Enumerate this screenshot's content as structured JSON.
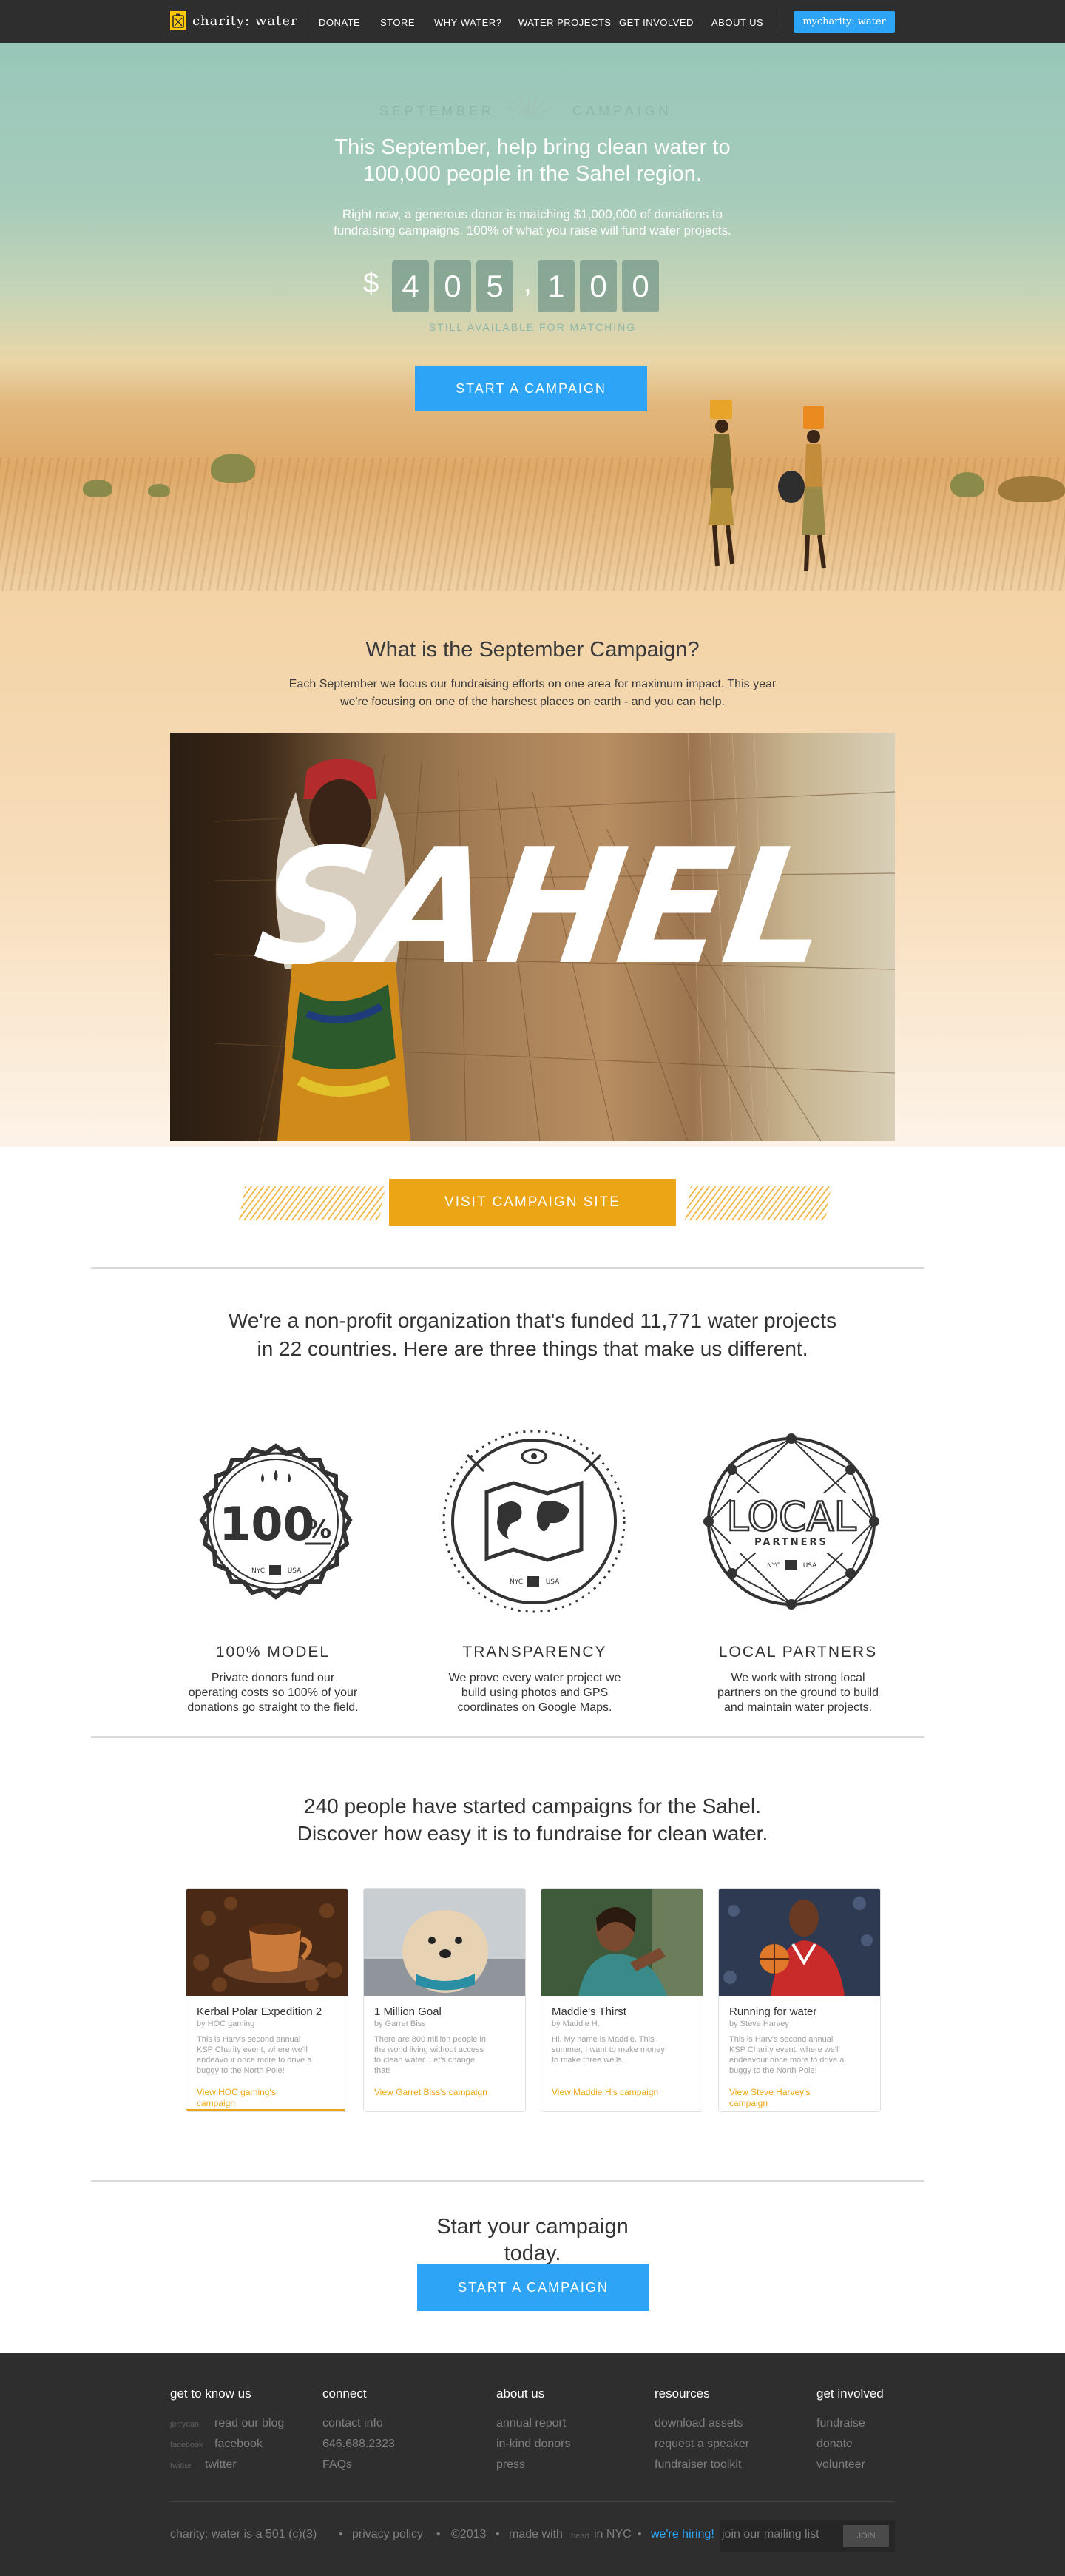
{
  "nav": {
    "logo_text": "charity: water",
    "items": [
      "DONATE",
      "STORE",
      "WHY WATER?",
      "WATER PROJECTS",
      "GET INVOLVED",
      "ABOUT US"
    ],
    "mycharity_label": "mycharity: water",
    "colors": {
      "bg": "#2e2e2e",
      "accent": "#2ea4f7",
      "logo": "#ffc907"
    }
  },
  "hero": {
    "label_left": "SEPTEMBER",
    "label_right": "CAMPAIGN",
    "headline_line1": "This September, help bring clean water to",
    "headline_line2": "100,000 people in the Sahel region.",
    "body_line1": "Right now, a generous donor is matching $1,000,000 of donations to",
    "body_line2": "fundraising campaigns. 100% of what you raise will fund water projects.",
    "counter": {
      "currency": "$",
      "digits": [
        "4",
        "0",
        "5",
        "1",
        "0",
        "0"
      ],
      "separator": ",",
      "caption": "STILL AVAILABLE FOR MATCHING"
    },
    "cta_label": "START A CAMPAIGN"
  },
  "what": {
    "heading": "What is the September Campaign?",
    "body_line1": "Each September we focus our fundraising efforts on one area for maximum impact. This year",
    "body_line2": "we're focusing on one of the harshest places on earth - and you can help.",
    "hero_word": "SAHEL",
    "cta_label": "VISIT CAMPAIGN SITE"
  },
  "mission": {
    "line1": "We're a non-profit organization that's funded 11,771 water projects",
    "line2": "in 22 countries. Here are three things that make us different."
  },
  "features": [
    {
      "title": "100% MODEL",
      "lines": [
        "Private donors fund our",
        "operating costs so 100% of your",
        "donations go straight to the field."
      ],
      "badge_text": "100",
      "badge_suffix": "%",
      "badge_small_left": "NYC",
      "badge_small_right": "USA"
    },
    {
      "title": "TRANSPARENCY",
      "lines": [
        "We prove every water project we",
        "build using photos and GPS",
        "coordinates on Google Maps."
      ],
      "badge_small_left": "NYC",
      "badge_small_right": "USA"
    },
    {
      "title": "LOCAL PARTNERS",
      "lines": [
        "We work with strong local",
        "partners on the ground to build",
        "and maintain water projects."
      ],
      "badge_text": "LOCAL",
      "badge_sub": "PARTNERS",
      "badge_small_left": "NYC",
      "badge_small_right": "USA"
    }
  ],
  "campaigns": {
    "line1": "240 people have started campaigns for the Sahel.",
    "line2": "Discover how easy it is to fundraise for clean water.",
    "cards": [
      {
        "title": "Kerbal Polar Expedition 2",
        "by": "by HOC gaming",
        "desc": [
          "This is Harv's second annual",
          "KSP Charity event, where we'll",
          "endeavour once more to drive a",
          "buggy to the North Pole!"
        ],
        "link": [
          "View HOC gaming's",
          "campaign"
        ],
        "progress": 0.98
      },
      {
        "title": "1 Million Goal",
        "by": "by Garret Biss",
        "desc": [
          "There are 800 million people in",
          "the world living without access",
          "to clean water. Let's change",
          "that!"
        ],
        "link": [
          "View Garret Biss's campaign"
        ],
        "progress": 0
      },
      {
        "title": "Maddie's Thirst",
        "by": "by Maddie H.",
        "desc": [
          "Hi. My name is Maddie. This",
          "summer, I want to make money",
          "to make three wells."
        ],
        "link": [
          "View Maddie H's campaign"
        ],
        "progress": 0
      },
      {
        "title": "Running for water",
        "by": "by Steve Harvey",
        "desc": [
          "This is Harv's second annual",
          "KSP Charity event, where we'll",
          "endeavour once more to drive a",
          "buggy to the North Pole!"
        ],
        "link": [
          "View Steve Harvey's",
          "campaign"
        ],
        "progress": 0
      }
    ]
  },
  "start": {
    "line1": "Start your campaign",
    "line2": "today.",
    "cta_label": "START A CAMPAIGN"
  },
  "footer": {
    "columns": [
      {
        "heading": "get to know us",
        "links": [
          {
            "tag": "jerrycan",
            "label": "read our blog"
          },
          {
            "tag": "facebook",
            "label": "facebook"
          },
          {
            "tag": "twitter",
            "label": "twitter"
          }
        ]
      },
      {
        "heading": "connect",
        "links": [
          {
            "label": "contact info"
          },
          {
            "label": "646.688.2323"
          },
          {
            "label": "FAQs"
          }
        ]
      },
      {
        "heading": "about us",
        "links": [
          {
            "label": "annual report"
          },
          {
            "label": "in-kind donors"
          },
          {
            "label": "press"
          }
        ]
      },
      {
        "heading": "resources",
        "links": [
          {
            "label": "download assets"
          },
          {
            "label": "request a speaker"
          },
          {
            "label": "fundraiser toolkit"
          }
        ]
      },
      {
        "heading": "get involved",
        "links": [
          {
            "label": "fundraise"
          },
          {
            "label": "donate"
          },
          {
            "label": "volunteer"
          }
        ]
      }
    ],
    "bottom": {
      "legal": "charity: water is a 501 (c)(3)",
      "privacy": "privacy policy",
      "copyright": "©2013",
      "made_with": "made with",
      "heart": "heart",
      "made_in": "in NYC",
      "hiring": "we're hiring!",
      "mailing": "join our mailing list",
      "join": "JOIN"
    }
  }
}
